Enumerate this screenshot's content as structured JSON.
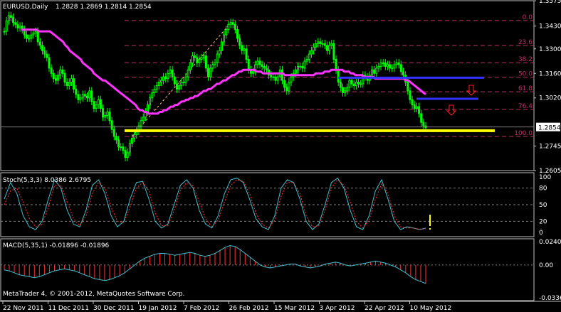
{
  "colors": {
    "background": "#000000",
    "frame": "#c0c0c0",
    "text": "#ffffff",
    "bull_candle": "#00ff00",
    "bear_candle": "#00ff00",
    "moving_average": "#ff33ff",
    "fib_lines": "#c0306a",
    "support_yellow": "#ffff00",
    "support_blue": "#3333ff",
    "arrow": "#ff2020",
    "stoch_main": "#40c0d0",
    "stoch_signal": "#ff3030",
    "macd_hist": "#ff3030",
    "macd_signal": "#40c0d0",
    "grid_dash": "#808080",
    "current_price_bg": "#ffffff",
    "current_price_text": "#000000"
  },
  "chart_data": [
    {
      "type": "candlestick",
      "title": "EURUSD,Daily",
      "ohlc_label": "1.2828 1.2869 1.2814 1.2854",
      "current_price": 1.2854,
      "ylim": [
        1.2605,
        1.3575
      ],
      "y_ticks": [
        1.3575,
        1.343,
        1.33,
        1.316,
        1.302,
        1.2745,
        1.2605
      ],
      "y_tick_labels": [
        "1.3575",
        "1.3430",
        "1.3300",
        "1.3160",
        "1.3020",
        "1.2745",
        "1.2605"
      ],
      "current_price_label": "1.2854",
      "x_tick_labels": [
        "22 Nov 2011",
        "11 Dec 2011",
        "30 Dec 2011",
        "19 Jan 2012",
        "7 Feb 2012",
        "26 Feb 2012",
        "15 Mar 2012",
        "3 Apr 2012",
        "22 Apr 2012",
        "10 May 2012"
      ],
      "close_series": [
        1.34,
        1.346,
        1.349,
        1.348,
        1.345,
        1.344,
        1.342,
        1.343,
        1.341,
        1.338,
        1.336,
        1.336,
        1.338,
        1.339,
        1.34,
        1.334,
        1.332,
        1.329,
        1.327,
        1.325,
        1.319,
        1.316,
        1.313,
        1.312,
        1.315,
        1.318,
        1.316,
        1.311,
        1.309,
        1.311,
        1.313,
        1.307,
        1.304,
        1.301,
        1.302,
        1.304,
        1.303,
        1.302,
        1.306,
        1.3,
        1.296,
        1.298,
        1.301,
        1.296,
        1.291,
        1.292,
        1.294,
        1.289,
        1.284,
        1.28,
        1.278,
        1.274,
        1.274,
        1.272,
        1.268,
        1.271,
        1.276,
        1.279,
        1.281,
        1.283,
        1.286,
        1.289,
        1.291,
        1.294,
        1.298,
        1.302,
        1.305,
        1.307,
        1.309,
        1.311,
        1.312,
        1.314,
        1.313,
        1.316,
        1.318,
        1.314,
        1.31,
        1.307,
        1.309,
        1.311,
        1.311,
        1.314,
        1.318,
        1.322,
        1.326,
        1.325,
        1.322,
        1.324,
        1.325,
        1.326,
        1.319,
        1.314,
        1.319,
        1.321,
        1.322,
        1.327,
        1.329,
        1.334,
        1.338,
        1.341,
        1.344,
        1.345,
        1.344,
        1.341,
        1.336,
        1.332,
        1.329,
        1.33,
        1.324,
        1.318,
        1.316,
        1.317,
        1.321,
        1.323,
        1.321,
        1.32,
        1.319,
        1.318,
        1.315,
        1.314,
        1.314,
        1.312,
        1.314,
        1.318,
        1.312,
        1.308,
        1.306,
        1.311,
        1.314,
        1.316,
        1.318,
        1.32,
        1.32,
        1.319,
        1.323,
        1.324,
        1.327,
        1.329,
        1.331,
        1.333,
        1.334,
        1.333,
        1.333,
        1.332,
        1.329,
        1.332,
        1.333,
        1.324,
        1.318,
        1.311,
        1.308,
        1.305,
        1.306,
        1.308,
        1.312,
        1.31,
        1.309,
        1.311,
        1.31,
        1.31,
        1.315,
        1.314,
        1.312,
        1.315,
        1.318,
        1.316,
        1.319,
        1.32,
        1.322,
        1.322,
        1.32,
        1.321,
        1.319,
        1.319,
        1.321,
        1.322,
        1.321,
        1.317,
        1.315,
        1.311,
        1.306,
        1.301,
        1.298,
        1.296,
        1.297,
        1.293,
        1.288,
        1.286,
        1.285
      ],
      "moving_average": [
        1.341,
        1.341,
        1.341,
        1.341,
        1.341,
        1.341,
        1.341,
        1.341,
        1.34,
        1.34,
        1.34,
        1.34,
        1.34,
        1.34,
        1.339,
        1.338,
        1.337,
        1.336,
        1.335,
        1.334,
        1.332,
        1.331,
        1.329,
        1.328,
        1.327,
        1.326,
        1.325,
        1.324,
        1.322,
        1.321,
        1.32,
        1.319,
        1.318,
        1.316,
        1.315,
        1.314,
        1.313,
        1.312,
        1.312,
        1.311,
        1.31,
        1.309,
        1.308,
        1.307,
        1.306,
        1.305,
        1.304,
        1.303,
        1.302,
        1.301,
        1.3,
        1.299,
        1.298,
        1.296,
        1.295,
        1.295,
        1.294,
        1.294,
        1.293,
        1.293,
        1.293,
        1.293,
        1.293,
        1.294,
        1.294,
        1.295,
        1.295,
        1.296,
        1.297,
        1.297,
        1.298,
        1.298,
        1.299,
        1.3,
        1.3,
        1.301,
        1.301,
        1.302,
        1.302,
        1.303,
        1.303,
        1.304,
        1.305,
        1.306,
        1.306,
        1.307,
        1.307,
        1.308,
        1.309,
        1.31,
        1.31,
        1.311,
        1.312,
        1.312,
        1.313,
        1.314,
        1.315,
        1.315,
        1.316,
        1.317,
        1.317,
        1.318,
        1.318,
        1.318,
        1.318,
        1.318,
        1.318,
        1.317,
        1.317,
        1.317,
        1.316,
        1.316,
        1.316,
        1.316,
        1.316,
        1.316,
        1.316,
        1.316,
        1.316,
        1.316,
        1.315,
        1.315,
        1.315,
        1.315,
        1.315,
        1.315,
        1.315,
        1.315,
        1.315,
        1.315,
        1.315,
        1.315,
        1.315,
        1.315,
        1.316,
        1.316,
        1.316,
        1.316,
        1.317,
        1.317,
        1.317,
        1.318,
        1.318,
        1.318,
        1.318,
        1.318,
        1.318,
        1.317,
        1.317,
        1.317,
        1.316,
        1.316,
        1.315,
        1.315,
        1.315,
        1.315,
        1.314,
        1.314,
        1.314,
        1.314,
        1.314,
        1.313,
        1.313,
        1.313,
        1.313,
        1.313,
        1.313,
        1.313,
        1.313,
        1.313,
        1.313,
        1.313,
        1.313,
        1.313,
        1.313,
        1.312,
        1.312,
        1.311,
        1.31,
        1.309,
        1.308,
        1.307,
        1.306,
        1.305,
        1.304
      ],
      "fibonacci_levels": [
        {
          "label": "0.0",
          "value": 1.3462
        },
        {
          "label": "23.6",
          "value": 1.3319
        },
        {
          "label": "38.2",
          "value": 1.3221
        },
        {
          "label": "50.0",
          "value": 1.3138
        },
        {
          "label": "61.8",
          "value": 1.3055
        },
        {
          "label": "76.4",
          "value": 1.2954
        },
        {
          "label": "100.0",
          "value": 1.28
        }
      ],
      "support_lines": [
        {
          "color": "yellow",
          "value": 1.2833
        },
        {
          "color": "blue",
          "value": 1.3135
        },
        {
          "color": "blue",
          "value": 1.3015
        }
      ]
    },
    {
      "type": "line",
      "title": "Stoch(5,3,3) 8.0386 2.6795",
      "ylim": [
        0,
        100
      ],
      "y_ticks": [
        100,
        80,
        50,
        20,
        0
      ],
      "y_tick_labels": [
        "100",
        "80",
        "50",
        "20",
        "0"
      ],
      "series": [
        {
          "name": "Main",
          "values": [
            60,
            90,
            70,
            30,
            10,
            5,
            20,
            60,
            95,
            80,
            40,
            15,
            10,
            40,
            85,
            95,
            70,
            30,
            10,
            20,
            60,
            90,
            92,
            60,
            20,
            8,
            15,
            50,
            85,
            95,
            80,
            40,
            15,
            8,
            30,
            70,
            95,
            98,
            90,
            60,
            25,
            10,
            5,
            30,
            80,
            95,
            90,
            60,
            20,
            5,
            15,
            50,
            90,
            98,
            80,
            40,
            10,
            5,
            30,
            75,
            95,
            60,
            20,
            5,
            10,
            8,
            5,
            8
          ]
        },
        {
          "name": "Signal",
          "values": [
            50,
            75,
            80,
            55,
            25,
            10,
            15,
            45,
            85,
            85,
            55,
            25,
            12,
            30,
            70,
            90,
            80,
            45,
            20,
            18,
            45,
            80,
            90,
            75,
            35,
            12,
            12,
            40,
            75,
            90,
            85,
            55,
            25,
            10,
            22,
            55,
            85,
            95,
            92,
            70,
            35,
            15,
            8,
            22,
            65,
            90,
            90,
            70,
            30,
            10,
            12,
            40,
            80,
            95,
            85,
            55,
            20,
            8,
            22,
            60,
            88,
            70,
            30,
            10,
            8,
            8,
            6,
            6
          ]
        }
      ]
    },
    {
      "type": "bar",
      "title": "MACD(5,35,1) -0.01896 -0.01896",
      "ylim": [
        -0.03367,
        0.02402
      ],
      "y_ticks": [
        0.02402,
        0.0,
        -0.03367
      ],
      "y_tick_labels": [
        "0.02402",
        "0.00",
        "-0.03367"
      ],
      "values": [
        -0.005,
        -0.006,
        -0.008,
        -0.01,
        -0.011,
        -0.012,
        -0.013,
        -0.012,
        -0.01,
        -0.008,
        -0.006,
        -0.005,
        -0.004,
        -0.005,
        -0.006,
        -0.008,
        -0.01,
        -0.012,
        -0.014,
        -0.015,
        -0.016,
        -0.015,
        -0.013,
        -0.011,
        -0.008,
        -0.004,
        0.0,
        0.004,
        0.007,
        0.009,
        0.011,
        0.012,
        0.012,
        0.011,
        0.01,
        0.011,
        0.012,
        0.013,
        0.012,
        0.01,
        0.009,
        0.01,
        0.012,
        0.015,
        0.018,
        0.02,
        0.019,
        0.016,
        0.012,
        0.008,
        0.004,
        0.0,
        -0.002,
        -0.003,
        -0.002,
        -0.001,
        0.0,
        0.001,
        0.001,
        -0.001,
        -0.002,
        -0.003,
        -0.002,
        -0.001,
        0.001,
        0.002,
        0.003,
        0.002,
        0.0,
        -0.001,
        0.0,
        0.001,
        0.002,
        0.003,
        0.004,
        0.003,
        0.002,
        0.0,
        -0.002,
        -0.005,
        -0.008,
        -0.012,
        -0.015,
        -0.017,
        -0.019
      ]
    }
  ],
  "footer": {
    "copyright": "MetaTrader 4, © 2001-2012, MetaQuotes Software Corp."
  }
}
